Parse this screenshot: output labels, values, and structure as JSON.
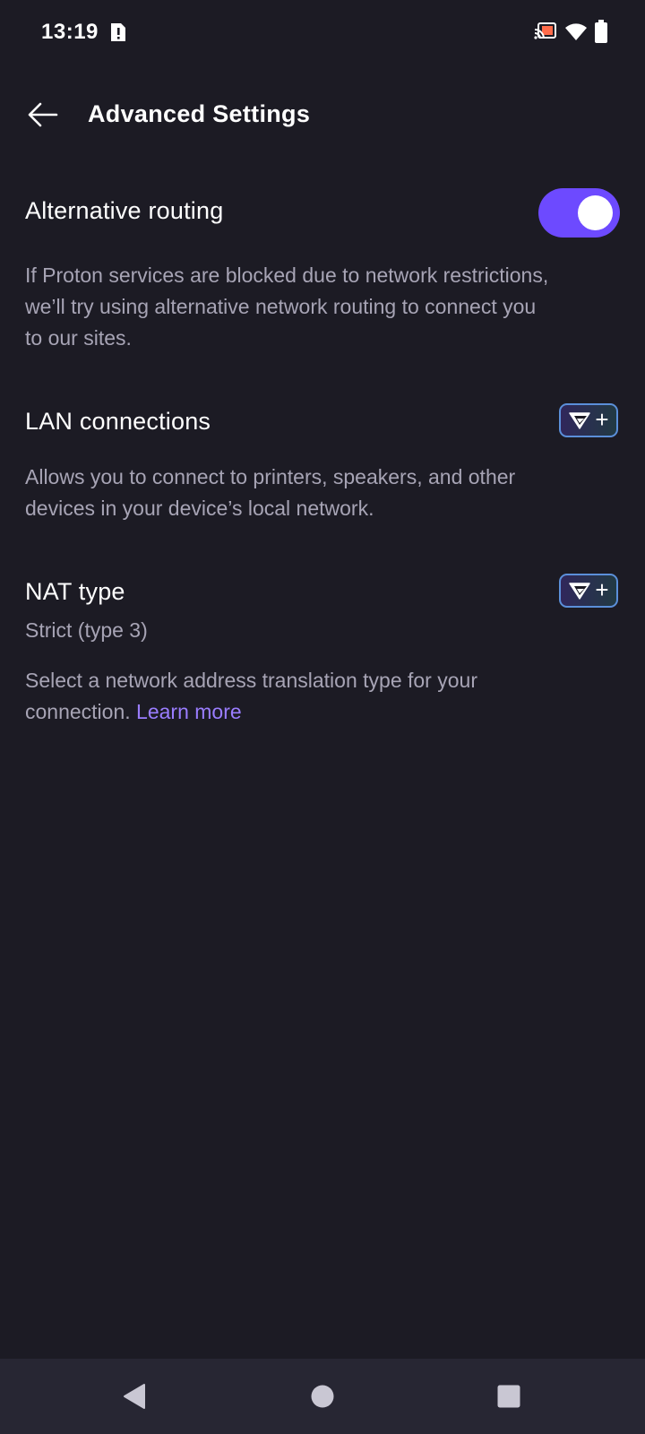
{
  "status_bar": {
    "time": "13:19"
  },
  "toolbar": {
    "title": "Advanced Settings"
  },
  "settings": {
    "alternative_routing": {
      "title": "Alternative routing",
      "enabled": true,
      "description_line1": "If Proton services are blocked due to network restrictions,",
      "description_line2": "we’ll try using alternative network routing to connect you",
      "description_line3": "to our sites."
    },
    "lan_connections": {
      "title": "LAN connections",
      "description_line1": "Allows you to connect to printers, speakers, and other",
      "description_line2": "devices in your device’s local network."
    },
    "nat_type": {
      "title": "NAT type",
      "value": "Strict (type 3)",
      "description_line1": "Select a network address translation type for your",
      "description_line2": "connection.",
      "learn_more": "Learn more"
    }
  },
  "upsell_badge": {
    "plus": "+"
  },
  "colors": {
    "background": "#1c1b24",
    "accent": "#6d4aff",
    "link": "#9a7dff",
    "secondary_text": "#a7a4b5",
    "cast_icon": "#ff6b4a"
  },
  "icons": {
    "sim": "sim-alert-icon",
    "cast": "cast-icon",
    "wifi": "wifi-icon",
    "battery": "battery-icon",
    "back": "arrow-left-icon",
    "upsell": "vpn-plus-icon",
    "nav_back": "triangle-back-icon",
    "nav_home": "circle-home-icon",
    "nav_recents": "square-recents-icon"
  }
}
